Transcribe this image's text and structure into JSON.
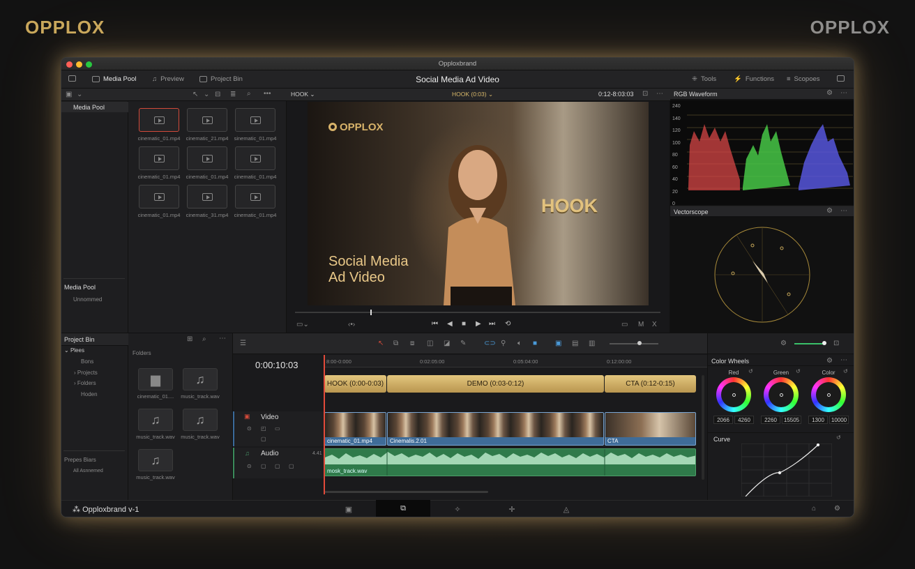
{
  "brand": {
    "left": "OPPLOX",
    "right": "OPPLOX"
  },
  "window": {
    "title": "Opploxbrand"
  },
  "toolbar": {
    "media_pool": "Media Pool",
    "preview": "Preview",
    "project_bin": "Project Bin",
    "title": "Social Media Ad Video",
    "tools": "Tools",
    "functions": "Functions",
    "scopes": "Scopoes"
  },
  "media_pool": {
    "sidebar_item": "Media Pool",
    "section_title": "Media Pool",
    "section_sub": "Unnommed",
    "clips": [
      "cinematic_01.mp4",
      "cinematic_21.mp4",
      "sinematic_01.mp4",
      "cinematic_01.mp4",
      "cinematic_01.mp4",
      "cinematic_01.mp4",
      "cinematic_01.mp4",
      "cinematic_31.mp4",
      "cinematic_01.mp4"
    ]
  },
  "project_bin": {
    "title": "Project Bin",
    "tree": [
      "Plees",
      "Bons",
      "Projects",
      "Folders",
      "Hoden"
    ],
    "folders_label": "Folders",
    "items": [
      "cinematic_01....",
      "music_track.wav",
      "music_track.wav",
      "music_track.wav",
      "music_track.wav"
    ],
    "presets": "Prepes Biars",
    "presets_sub": "All Asnnemed"
  },
  "viewer": {
    "dropdown": "HOOK",
    "center_dropdown": "HOOK (0:03)",
    "timecode": "0:12-8:03:03",
    "logo": "OPPLOX",
    "hook_text": "HOOK",
    "title_line1": "Social Media",
    "title_line2": "Ad Video"
  },
  "scopes": {
    "waveform_title": "RGB Waveform",
    "waveform_ticks": [
      "240",
      "140",
      "120",
      "100",
      "80",
      "60",
      "40",
      "20",
      "0"
    ],
    "vectorscope_title": "Vectorscope"
  },
  "timeline": {
    "timecode": "0:00:10:03",
    "ruler": [
      "8:00-0:000",
      "0:02:05:00",
      "0:05:04:00",
      "0:12:00:00"
    ],
    "segments": [
      "HOOK (0:00-0:03)",
      "DEMO (0:03-0:12)",
      "CTA (0:12-0:15)"
    ],
    "video_track": "Video",
    "audio_track": "Audio",
    "audio_level": "4.41",
    "video_clips": [
      "cinematic_01.mp4",
      "Cinemalis.2.01",
      "CTA"
    ],
    "audio_clip": "mosk_track.wav"
  },
  "color": {
    "title": "Color Wheels",
    "wheels": [
      {
        "label": "Red",
        "v1": "2066",
        "v2": "4260"
      },
      {
        "label": "Green",
        "v1": "2260",
        "v2": "15505"
      },
      {
        "label": "Color",
        "v1": "1300",
        "v2": "10000"
      }
    ],
    "curve_title": "Curve"
  },
  "footer": {
    "app_name": "Opploxbrand v-1"
  }
}
